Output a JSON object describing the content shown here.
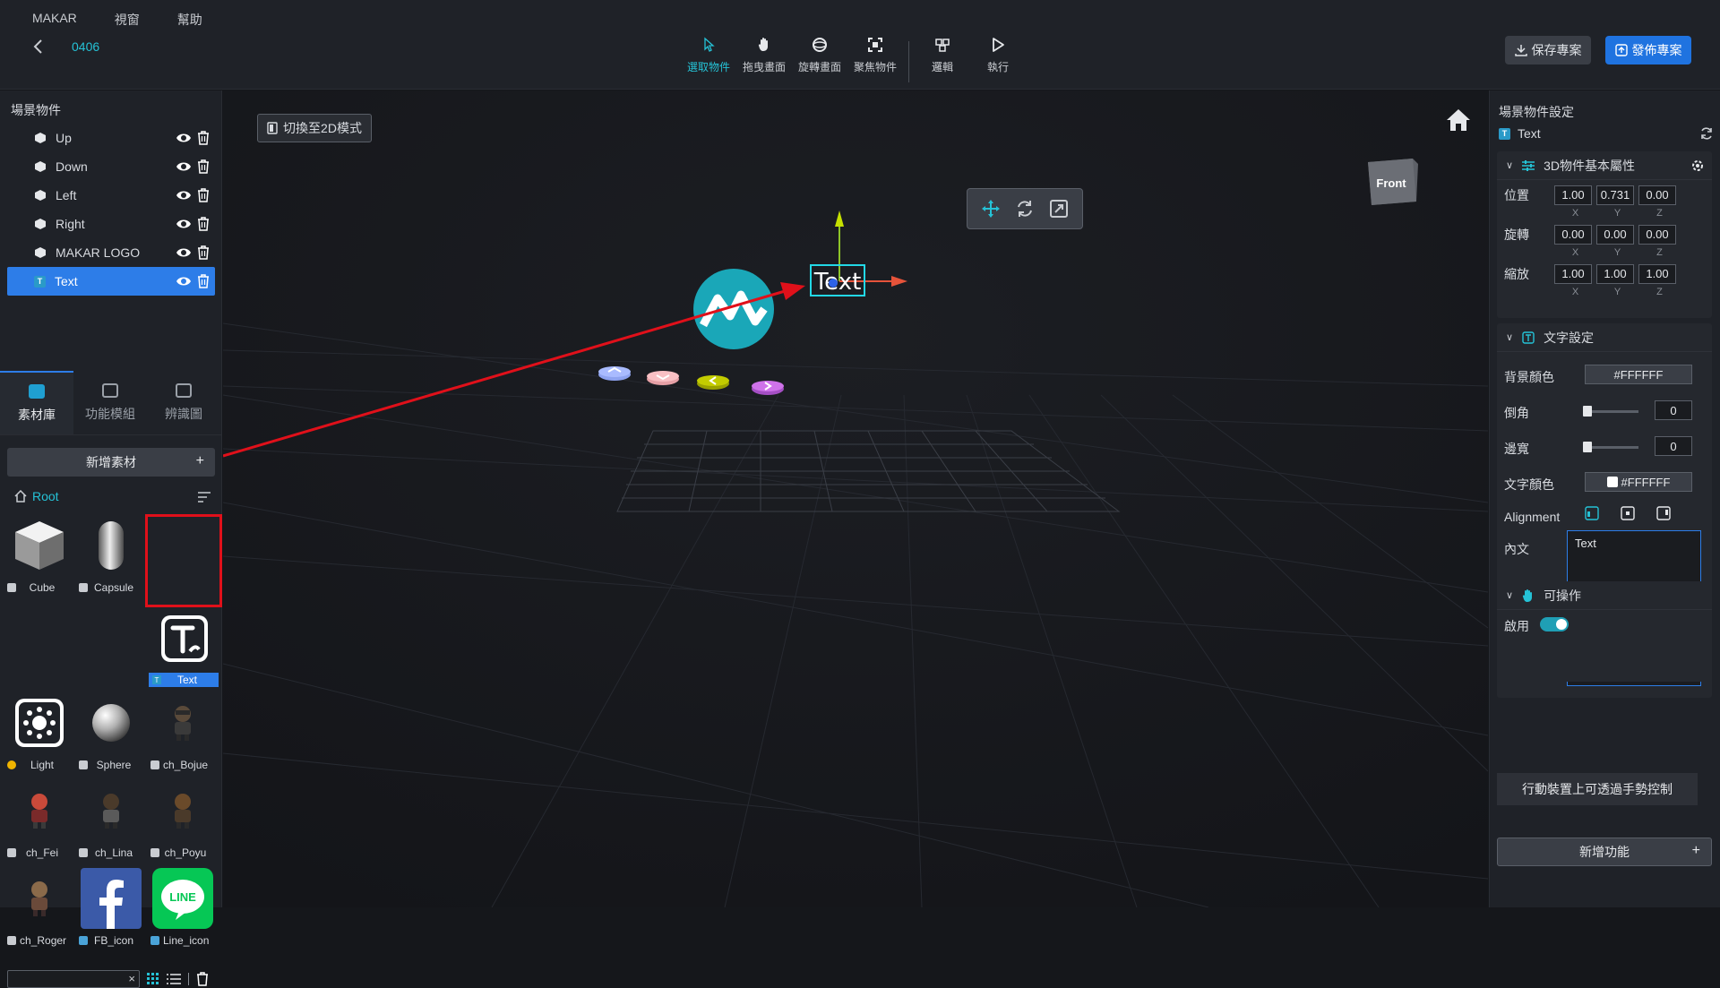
{
  "menu": [
    "MAKAR",
    "視窗",
    "幫助"
  ],
  "project": {
    "name": "0406"
  },
  "tools": [
    {
      "label": "選取物件",
      "icon": "cursor-icon",
      "active": true
    },
    {
      "label": "拖曳畫面",
      "icon": "hand-icon"
    },
    {
      "label": "旋轉畫面",
      "icon": "rotate-view-icon"
    },
    {
      "label": "聚焦物件",
      "icon": "focus-icon"
    },
    {
      "label": "邏輯",
      "icon": "logic-icon"
    },
    {
      "label": "執行",
      "icon": "play-icon"
    }
  ],
  "actions": {
    "save": "保存專案",
    "publish": "發佈專案"
  },
  "scene": {
    "title": "場景物件",
    "items": [
      {
        "label": "Up",
        "type": "3d"
      },
      {
        "label": "Down",
        "type": "3d"
      },
      {
        "label": "Left",
        "type": "3d"
      },
      {
        "label": "Right",
        "type": "3d"
      },
      {
        "label": "MAKAR LOGO",
        "type": "3d"
      },
      {
        "label": "Text",
        "type": "text",
        "selected": true
      }
    ]
  },
  "tabs": [
    {
      "label": "素材庫",
      "active": true
    },
    {
      "label": "功能模組"
    },
    {
      "label": "辨識圖"
    }
  ],
  "library": {
    "add_label": "新增素材",
    "root_label": "Root",
    "assets": [
      {
        "label": "Cube"
      },
      {
        "label": "Capsule"
      },
      {
        "label": "Text",
        "selected": true
      },
      {
        "label": "Light"
      },
      {
        "label": "Sphere"
      },
      {
        "label": "ch_Bojue"
      },
      {
        "label": "ch_Fei"
      },
      {
        "label": "ch_Lina"
      },
      {
        "label": "ch_Poyu"
      },
      {
        "label": "ch_Roger"
      },
      {
        "label": "FB_icon"
      },
      {
        "label": "Line_icon"
      }
    ]
  },
  "viewport": {
    "switch2d_label": "切換至2D模式",
    "text_object": "Text",
    "cube_face": "Front"
  },
  "properties": {
    "title": "場景物件設定",
    "object_name": "Text",
    "basic_section": "3D物件基本屬性",
    "rows": [
      {
        "label": "位置",
        "x": "1.00",
        "y": "0.731",
        "z": "0.00"
      },
      {
        "label": "旋轉",
        "x": "0.00",
        "y": "0.00",
        "z": "0.00"
      },
      {
        "label": "縮放",
        "x": "1.00",
        "y": "1.00",
        "z": "1.00"
      }
    ],
    "axes": [
      "X",
      "Y",
      "Z"
    ],
    "text_section": "文字設定",
    "bg_color_label": "背景顏色",
    "bg_color": "#FFFFFF",
    "radius_label": "倒角",
    "radius_value": "0",
    "border_label": "邊寬",
    "border_value": "0",
    "text_color_label": "文字顏色",
    "text_color": "#FFFFFF",
    "alignment_label": "Alignment",
    "content_label": "內文",
    "content_value": "Text",
    "interact_section": "可操作",
    "enable_label": "啟用",
    "gesture_label": "行動裝置上可透過手勢控制",
    "add_function_label": "新增功能"
  },
  "colors": {
    "accent": "#25c2d6",
    "primary": "#1f73e0",
    "selection": "#2d7de8",
    "annotation": "#e0101a"
  }
}
